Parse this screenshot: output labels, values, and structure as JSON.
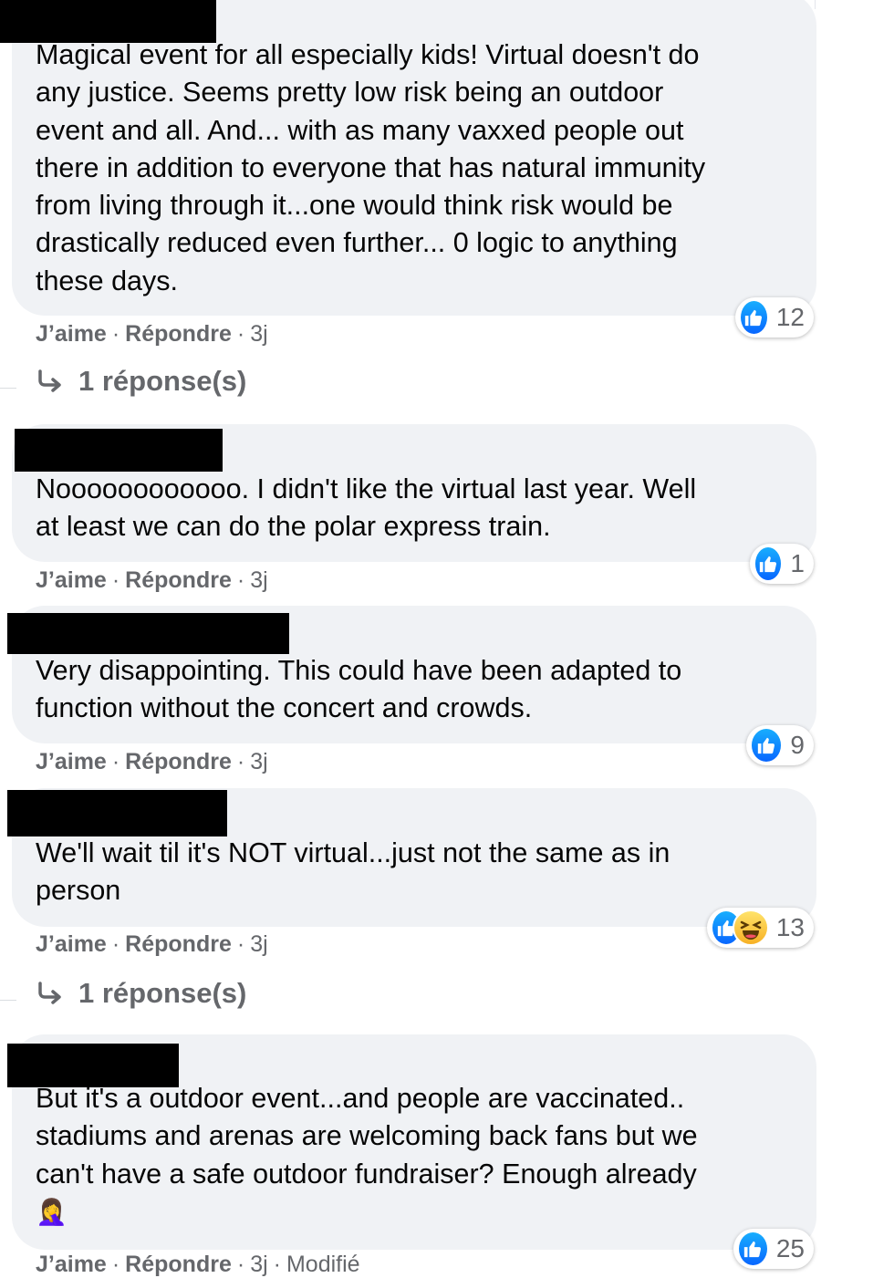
{
  "colors": {
    "bubble_bg": "#f0f2f5",
    "meta_text": "#65676b",
    "like_blue": "#0866ff",
    "redaction": "#000000"
  },
  "comments": [
    {
      "lines": [
        "Magical event for all especially kids! Virtual doesn't do",
        "any justice. Seems pretty low risk being an outdoor",
        "event and all. And... with as many vaxxed people out",
        "there in addition to everyone that has natural immunity",
        "from living through it...one would think risk would be",
        "drastically reduced even further... 0 logic to anything",
        "these days."
      ],
      "like_label": "J’aime",
      "reply_label": "Répondre",
      "time": "3j",
      "reaction_icons": [
        "like-icon"
      ],
      "reaction_count": "12",
      "replies_label": "1 réponse(s)"
    },
    {
      "lines": [
        "Noooooooooooo. I didn't like the virtual last year. Well",
        "at least we can do the polar express train."
      ],
      "like_label": "J’aime",
      "reply_label": "Répondre",
      "time": "3j",
      "reaction_icons": [
        "like-icon"
      ],
      "reaction_count": "1"
    },
    {
      "lines": [
        "Very disappointing. This could have been adapted to",
        "function without the concert and crowds."
      ],
      "like_label": "J’aime",
      "reply_label": "Répondre",
      "time": "3j",
      "reaction_icons": [
        "like-icon"
      ],
      "reaction_count": "9"
    },
    {
      "lines": [
        "We'll wait til it's NOT virtual...just not the same as in",
        "person"
      ],
      "like_label": "J’aime",
      "reply_label": "Répondre",
      "time": "3j",
      "reaction_icons": [
        "like-icon",
        "haha-icon"
      ],
      "reaction_count": "13",
      "replies_label": "1 réponse(s)"
    },
    {
      "lines": [
        "But it's a outdoor event...and people are vaccinated..",
        "stadiums and arenas are welcoming back fans but we",
        "can't have a safe outdoor fundraiser? Enough already"
      ],
      "emoji": "🤦‍♀️",
      "like_label": "J’aime",
      "reply_label": "Répondre",
      "time": "3j",
      "edited_label": "Modifié",
      "reaction_icons": [
        "like-icon"
      ],
      "reaction_count": "25"
    }
  ]
}
